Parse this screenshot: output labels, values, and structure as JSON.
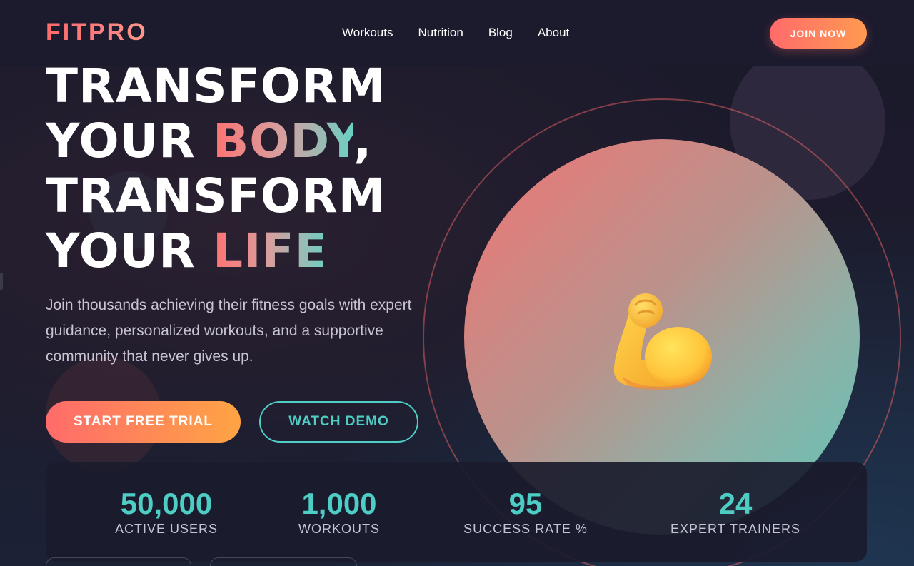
{
  "header": {
    "logo": "FITPRO",
    "nav": [
      "Workouts",
      "Nutrition",
      "Blog",
      "About"
    ],
    "join_label": "JOIN NOW"
  },
  "hero": {
    "line1": "TRANSFORM",
    "line2_prefix": "YOUR ",
    "line2_highlight": "BODY",
    "line2_suffix": ",",
    "line3": "TRANSFORM",
    "line4_prefix": "YOUR ",
    "line4_highlight": "LIFE",
    "description": "Join thousands achieving their fitness goals with expert guidance, personalized workouts, and a supportive community that never gives up.",
    "primary_cta": "START FREE TRIAL",
    "secondary_cta": "WATCH DEMO",
    "illustration_icon": "flexed-biceps-icon"
  },
  "stats": [
    {
      "value": "50,000",
      "label": "ACTIVE USERS"
    },
    {
      "value": "1,000",
      "label": "WORKOUTS"
    },
    {
      "value": "95",
      "label": "SUCCESS RATE %"
    },
    {
      "value": "24",
      "label": "EXPERT TRAINERS"
    }
  ],
  "colors": {
    "accent_coral": "#ff6b6b",
    "accent_teal": "#4ecdc4",
    "accent_orange": "#ffa444",
    "background": "#1b1a2b"
  }
}
